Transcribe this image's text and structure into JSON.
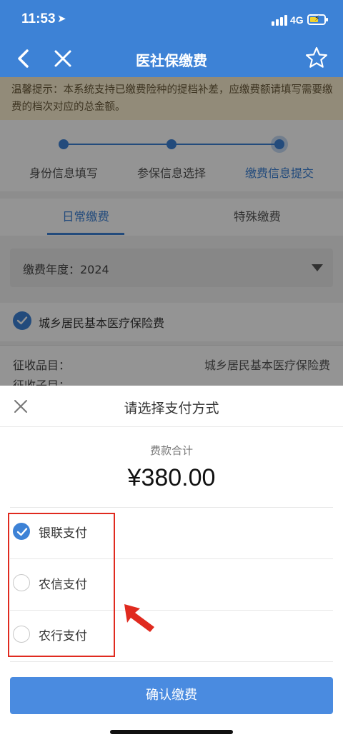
{
  "status_bar": {
    "time": "11:53",
    "network": "4G"
  },
  "nav": {
    "title": "医社保缴费"
  },
  "notice": "温馨提示：本系统支持已缴费险种的提档补差，应缴费额请填写需要缴费的档次对应的总金额。",
  "steps": [
    {
      "label": "身份信息填写"
    },
    {
      "label": "参保信息选择"
    },
    {
      "label": "缴费信息提交"
    }
  ],
  "tabs": [
    {
      "label": "日常缴费"
    },
    {
      "label": "特殊缴费"
    }
  ],
  "year_select": {
    "label": "缴费年度：2024"
  },
  "insurance_item": "城乡居民基本医疗保险费",
  "field": {
    "key": "征收品目：",
    "value": "城乡居民基本医疗保险费",
    "key2": "征收子目："
  },
  "payment_sheet": {
    "title": "请选择支付方式",
    "sum_label": "费款合计",
    "amount": "¥380.00",
    "options": [
      {
        "label": "银联支付"
      },
      {
        "label": "农信支付"
      },
      {
        "label": "农行支付"
      }
    ],
    "confirm": "确认缴费"
  },
  "colors": {
    "primary": "#3d82d6",
    "annotation": "#e02a1f",
    "notice_bg": "#fbefd0"
  }
}
